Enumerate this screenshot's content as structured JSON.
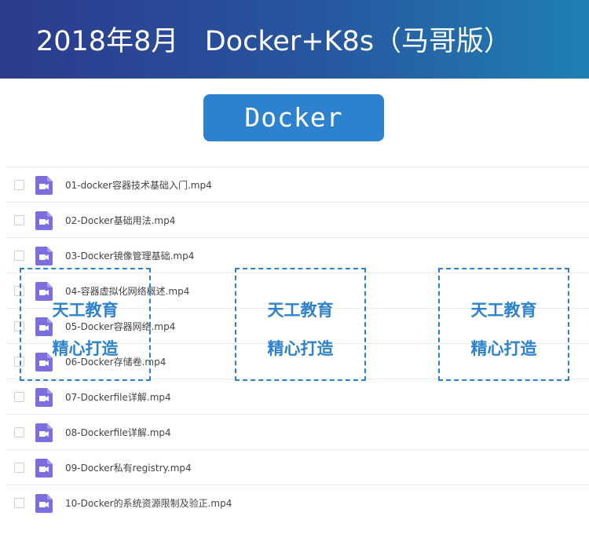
{
  "banner": {
    "title": "2018年8月   Docker+K8s（马哥版）"
  },
  "section": {
    "label": "Docker"
  },
  "files": [
    {
      "name": "01-docker容器技术基础入门.mp4",
      "icon": "video-file-icon"
    },
    {
      "name": "02-Docker基础用法.mp4",
      "icon": "video-file-icon"
    },
    {
      "name": "03-Docker镜像管理基础.mp4",
      "icon": "video-file-icon"
    },
    {
      "name": "04-容器虚拟化网络概述.mp4",
      "icon": "video-file-icon"
    },
    {
      "name": "05-Docker容器网络.mp4",
      "icon": "video-file-icon"
    },
    {
      "name": "06-Docker存储卷.mp4",
      "icon": "video-file-icon"
    },
    {
      "name": "07-Dockerfile详解.mp4",
      "icon": "video-file-icon"
    },
    {
      "name": "08-Dockerfile详解.mp4",
      "icon": "video-file-icon"
    },
    {
      "name": "09-Docker私有registry.mp4",
      "icon": "video-file-icon"
    },
    {
      "name": "10-Docker的系统资源限制及验正.mp4",
      "icon": "video-file-icon"
    }
  ],
  "watermarks": [
    {
      "line1": "天工教育",
      "line2": "精心打造"
    },
    {
      "line1": "天工教育",
      "line2": "精心打造"
    },
    {
      "line1": "天工教育",
      "line2": "精心打造"
    }
  ],
  "colors": {
    "banner_start": "#2c3a8c",
    "banner_end": "#1f80b3",
    "accent": "#2d82d0",
    "video_icon": "#7b6fe0"
  }
}
